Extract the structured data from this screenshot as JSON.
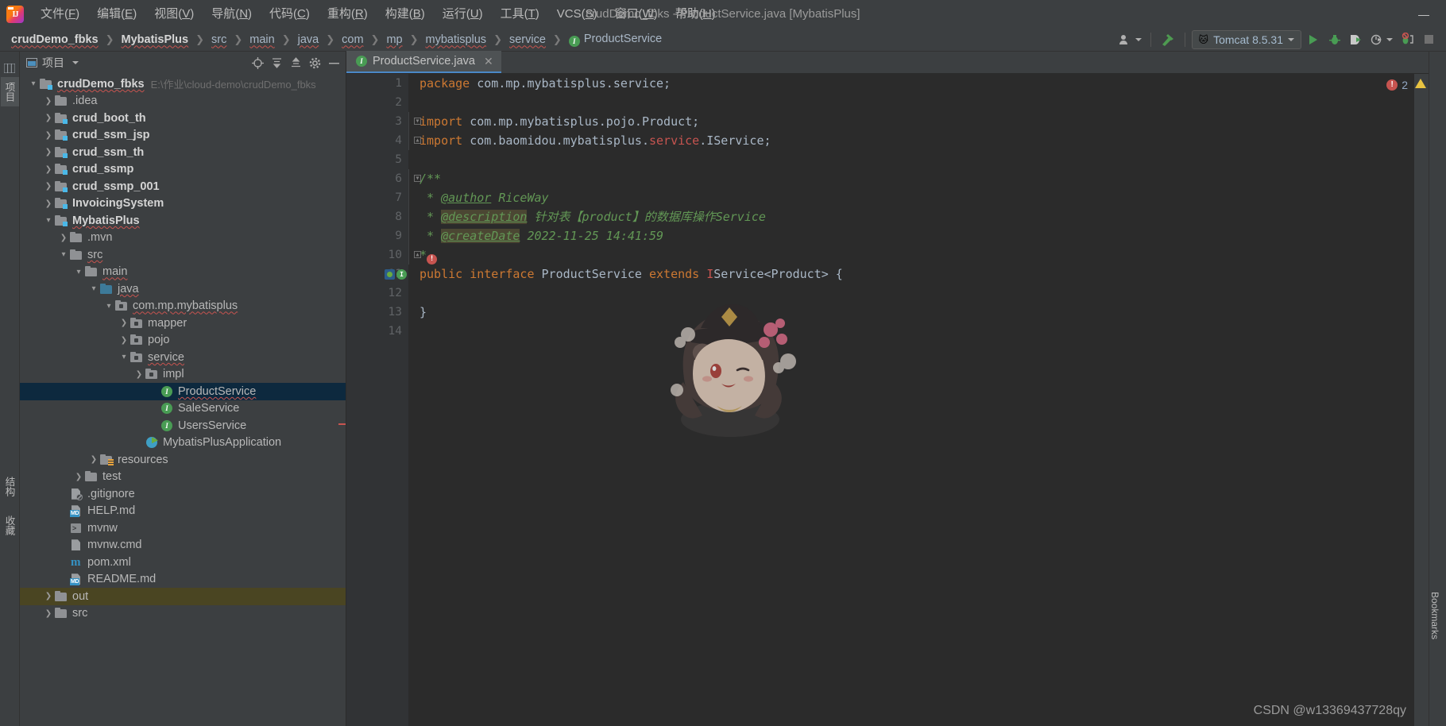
{
  "window": {
    "title": "crudDemo_fbks - ProductService.java [MybatisPlus]",
    "minimize_label": "—",
    "maximize_label": "□",
    "close_label": "✕"
  },
  "menu": {
    "logo_name": "intellij-idea-logo",
    "items": [
      {
        "text": "文件",
        "mnemonic": "F"
      },
      {
        "text": "编辑",
        "mnemonic": "E"
      },
      {
        "text": "视图",
        "mnemonic": "V"
      },
      {
        "text": "导航",
        "mnemonic": "N"
      },
      {
        "text": "代码",
        "mnemonic": "C"
      },
      {
        "text": "重构",
        "mnemonic": "R"
      },
      {
        "text": "构建",
        "mnemonic": "B"
      },
      {
        "text": "运行",
        "mnemonic": "U"
      },
      {
        "text": "工具",
        "mnemonic": "T"
      },
      {
        "text": "VCS",
        "mnemonic": "S"
      },
      {
        "text": "窗口",
        "mnemonic": "W"
      },
      {
        "text": "帮助",
        "mnemonic": "H"
      }
    ]
  },
  "navbar": {
    "crumbs": [
      {
        "label": "crudDemo_fbks",
        "bold": true,
        "squiggle": true,
        "icon": null
      },
      {
        "label": "MybatisPlus",
        "bold": true,
        "squiggle": true,
        "icon": null
      },
      {
        "label": "src",
        "bold": false,
        "squiggle": true,
        "icon": null
      },
      {
        "label": "main",
        "bold": false,
        "squiggle": true,
        "icon": null
      },
      {
        "label": "java",
        "bold": false,
        "squiggle": true,
        "icon": null
      },
      {
        "label": "com",
        "bold": false,
        "squiggle": true,
        "icon": null
      },
      {
        "label": "mp",
        "bold": false,
        "squiggle": true,
        "icon": null
      },
      {
        "label": "mybatisplus",
        "bold": false,
        "squiggle": true,
        "icon": null
      },
      {
        "label": "service",
        "bold": false,
        "squiggle": true,
        "icon": null
      },
      {
        "label": "ProductService",
        "bold": false,
        "squiggle": false,
        "icon": "I"
      }
    ],
    "separator": "❯",
    "toolbar": {
      "user_icon": "user-settings-icon",
      "hammer_icon": "build-hammer-icon",
      "run_config": {
        "label": "Tomcat 8.5.31",
        "icon": "tomcat-cat-icon",
        "dropdown": "▾"
      },
      "run_icon": "run-play-icon",
      "debug_icon": "debug-bug-icon",
      "run_coverage_icon": "run-with-coverage-icon",
      "profile_icon": "profiler-icon",
      "attach_icon": "attach-debugger-icon",
      "stop_icon": "stop-icon"
    }
  },
  "left_strip": {
    "tabs": [
      {
        "label": "项目",
        "name": "project-tool-tab",
        "selected": true
      },
      {
        "label": "结构",
        "name": "structure-tool-tab",
        "selected": false
      },
      {
        "label": "收藏",
        "name": "favorites-tool-tab",
        "selected": false
      }
    ]
  },
  "right_strip": {
    "tabs": [
      {
        "label": "Bookmarks",
        "name": "bookmarks-tool-tab"
      }
    ]
  },
  "project_panel": {
    "title": "项目",
    "dropdown": "▾",
    "icons": {
      "locate": "locate-target-icon",
      "expand_all": "expand-all-icon",
      "collapse_all": "collapse-all-icon",
      "settings": "gear-icon",
      "hide": "hide-icon"
    },
    "tree": [
      {
        "label": "crudDemo_fbks",
        "sub": "E:\\作业\\cloud-demo\\crudDemo_fbks",
        "indent": 0,
        "arrow": "down",
        "icon": "folder-module",
        "bold": true,
        "squiggle": true,
        "selected": false
      },
      {
        "label": ".idea",
        "sub": "",
        "indent": 1,
        "arrow": "right",
        "icon": "folder",
        "bold": false,
        "squiggle": false,
        "selected": false
      },
      {
        "label": "crud_boot_th",
        "sub": "",
        "indent": 1,
        "arrow": "right",
        "icon": "folder-module",
        "bold": true,
        "squiggle": false,
        "selected": false
      },
      {
        "label": "crud_ssm_jsp",
        "sub": "",
        "indent": 1,
        "arrow": "right",
        "icon": "folder-module",
        "bold": true,
        "squiggle": false,
        "selected": false
      },
      {
        "label": "crud_ssm_th",
        "sub": "",
        "indent": 1,
        "arrow": "right",
        "icon": "folder-module",
        "bold": true,
        "squiggle": false,
        "selected": false
      },
      {
        "label": "crud_ssmp",
        "sub": "",
        "indent": 1,
        "arrow": "right",
        "icon": "folder-module",
        "bold": true,
        "squiggle": false,
        "selected": false
      },
      {
        "label": "crud_ssmp_001",
        "sub": "",
        "indent": 1,
        "arrow": "right",
        "icon": "folder-module",
        "bold": true,
        "squiggle": false,
        "selected": false
      },
      {
        "label": "InvoicingSystem",
        "sub": "",
        "indent": 1,
        "arrow": "right",
        "icon": "folder-module",
        "bold": true,
        "squiggle": false,
        "selected": false
      },
      {
        "label": "MybatisPlus",
        "sub": "",
        "indent": 1,
        "arrow": "down",
        "icon": "folder-module",
        "bold": true,
        "squiggle": true,
        "selected": false
      },
      {
        "label": ".mvn",
        "sub": "",
        "indent": 2,
        "arrow": "right",
        "icon": "folder",
        "bold": false,
        "squiggle": false,
        "selected": false
      },
      {
        "label": "src",
        "sub": "",
        "indent": 2,
        "arrow": "down",
        "icon": "folder",
        "bold": false,
        "squiggle": true,
        "selected": false
      },
      {
        "label": "main",
        "sub": "",
        "indent": 3,
        "arrow": "down",
        "icon": "folder",
        "bold": false,
        "squiggle": true,
        "selected": false
      },
      {
        "label": "java",
        "sub": "",
        "indent": 4,
        "arrow": "down",
        "icon": "folder-source",
        "bold": false,
        "squiggle": true,
        "selected": false
      },
      {
        "label": "com.mp.mybatisplus",
        "sub": "",
        "indent": 5,
        "arrow": "down",
        "icon": "folder-package",
        "bold": false,
        "squiggle": true,
        "selected": false
      },
      {
        "label": "mapper",
        "sub": "",
        "indent": 6,
        "arrow": "right",
        "icon": "folder-package",
        "bold": false,
        "squiggle": false,
        "selected": false
      },
      {
        "label": "pojo",
        "sub": "",
        "indent": 6,
        "arrow": "right",
        "icon": "folder-package",
        "bold": false,
        "squiggle": false,
        "selected": false
      },
      {
        "label": "service",
        "sub": "",
        "indent": 6,
        "arrow": "down",
        "icon": "folder-package",
        "bold": false,
        "squiggle": true,
        "selected": false
      },
      {
        "label": "impl",
        "sub": "",
        "indent": 7,
        "arrow": "right",
        "icon": "folder-package",
        "bold": false,
        "squiggle": false,
        "selected": false
      },
      {
        "label": "ProductService",
        "sub": "",
        "indent": 8,
        "arrow": "none",
        "icon": "interface",
        "bold": false,
        "squiggle": true,
        "selected": true
      },
      {
        "label": "SaleService",
        "sub": "",
        "indent": 8,
        "arrow": "none",
        "icon": "interface",
        "bold": false,
        "squiggle": false,
        "selected": false
      },
      {
        "label": "UsersService",
        "sub": "",
        "indent": 8,
        "arrow": "none",
        "icon": "interface",
        "bold": false,
        "squiggle": false,
        "selected": false
      },
      {
        "label": "MybatisPlusApplication",
        "sub": "",
        "indent": 7,
        "arrow": "none",
        "icon": "spring-boot",
        "bold": false,
        "squiggle": false,
        "selected": false
      },
      {
        "label": "resources",
        "sub": "",
        "indent": 4,
        "arrow": "right",
        "icon": "folder-resources",
        "bold": false,
        "squiggle": false,
        "selected": false
      },
      {
        "label": "test",
        "sub": "",
        "indent": 3,
        "arrow": "right",
        "icon": "folder",
        "bold": false,
        "squiggle": false,
        "selected": false
      },
      {
        "label": ".gitignore",
        "sub": "",
        "indent": 2,
        "arrow": "none",
        "icon": "file-ignored",
        "bold": false,
        "squiggle": false,
        "selected": false
      },
      {
        "label": "HELP.md",
        "sub": "",
        "indent": 2,
        "arrow": "none",
        "icon": "file-markdown",
        "bold": false,
        "squiggle": false,
        "selected": false
      },
      {
        "label": "mvnw",
        "sub": "",
        "indent": 2,
        "arrow": "none",
        "icon": "file-script",
        "bold": false,
        "squiggle": false,
        "selected": false
      },
      {
        "label": "mvnw.cmd",
        "sub": "",
        "indent": 2,
        "arrow": "none",
        "icon": "file-plain",
        "bold": false,
        "squiggle": false,
        "selected": false
      },
      {
        "label": "pom.xml",
        "sub": "",
        "indent": 2,
        "arrow": "none",
        "icon": "file-maven",
        "bold": false,
        "squiggle": false,
        "selected": false
      },
      {
        "label": "README.md",
        "sub": "",
        "indent": 2,
        "arrow": "none",
        "icon": "file-markdown",
        "bold": false,
        "squiggle": false,
        "selected": false
      },
      {
        "label": "out",
        "sub": "",
        "indent": 1,
        "arrow": "right",
        "icon": "folder-excluded",
        "bold": false,
        "squiggle": false,
        "selected": false,
        "highlight": true
      },
      {
        "label": "src",
        "sub": "",
        "indent": 1,
        "arrow": "right",
        "icon": "folder",
        "bold": false,
        "squiggle": false,
        "selected": false
      }
    ]
  },
  "editor": {
    "tab": {
      "label": "ProductService.java",
      "icon": "I",
      "close": "✕"
    },
    "inspection": {
      "error_count": "2",
      "error_icon": "error-circle-icon",
      "warning_icon": "warning-triangle-icon"
    },
    "lines": [
      {
        "n": "1",
        "segs": [
          {
            "t": "package ",
            "c": "kw"
          },
          {
            "t": "com.mp.mybatisplus.service;",
            "c": "ident"
          }
        ],
        "fold": "",
        "icons": []
      },
      {
        "n": "2",
        "segs": [],
        "fold": "",
        "icons": []
      },
      {
        "n": "3",
        "segs": [
          {
            "t": "import ",
            "c": "kw"
          },
          {
            "t": "com.mp.mybatisplus.pojo.Product;",
            "c": "ident"
          }
        ],
        "fold": "top",
        "icons": []
      },
      {
        "n": "4",
        "segs": [
          {
            "t": "import ",
            "c": "kw"
          },
          {
            "t": "com.baomidou.mybatisplus.",
            "c": "ident"
          },
          {
            "t": "service",
            "c": "red"
          },
          {
            "t": ".IService;",
            "c": "ident"
          }
        ],
        "fold": "bottom",
        "icons": []
      },
      {
        "n": "5",
        "segs": [],
        "fold": "",
        "icons": []
      },
      {
        "n": "6",
        "segs": [
          {
            "t": "/**",
            "c": "doc"
          }
        ],
        "fold": "top",
        "icons": []
      },
      {
        "n": "7",
        "segs": [
          {
            "t": " * ",
            "c": "doc"
          },
          {
            "t": "@author",
            "c": "doctag"
          },
          {
            "t": " RiceWay",
            "c": "doc"
          }
        ],
        "fold": "",
        "icons": []
      },
      {
        "n": "8",
        "segs": [
          {
            "t": " * ",
            "c": "doc"
          },
          {
            "t": "@description",
            "c": "doctag dochl"
          },
          {
            "t": " 针对表【product】的数据库操作Service",
            "c": "doc"
          }
        ],
        "fold": "",
        "icons": []
      },
      {
        "n": "9",
        "segs": [
          {
            "t": " * ",
            "c": "doc"
          },
          {
            "t": "@createDate",
            "c": "doctag dochl"
          },
          {
            "t": " 2022-11-25 14:41:59",
            "c": "doc"
          }
        ],
        "fold": "",
        "icons": []
      },
      {
        "n": "10",
        "segs": [
          {
            "t": "*",
            "c": "doc"
          }
        ],
        "fold": "bottom",
        "icons": [],
        "bulb": true
      },
      {
        "n": "11",
        "segs": [
          {
            "t": "public interface ",
            "c": "kw"
          },
          {
            "t": "ProductService ",
            "c": "ident"
          },
          {
            "t": "extends ",
            "c": "kw"
          },
          {
            "t": "I",
            "c": "red"
          },
          {
            "t": "Service",
            "c": "ident"
          },
          {
            "t": "<Product> {",
            "c": "ident"
          }
        ],
        "fold": "",
        "icons": [
          "override",
          "implemented"
        ]
      },
      {
        "n": "12",
        "segs": [],
        "fold": "",
        "icons": []
      },
      {
        "n": "13",
        "segs": [
          {
            "t": "}",
            "c": "ident"
          }
        ],
        "fold": "",
        "icons": []
      },
      {
        "n": "14",
        "segs": [],
        "fold": "",
        "icons": []
      }
    ],
    "watermark": "CSDN @w13369437728qy"
  }
}
